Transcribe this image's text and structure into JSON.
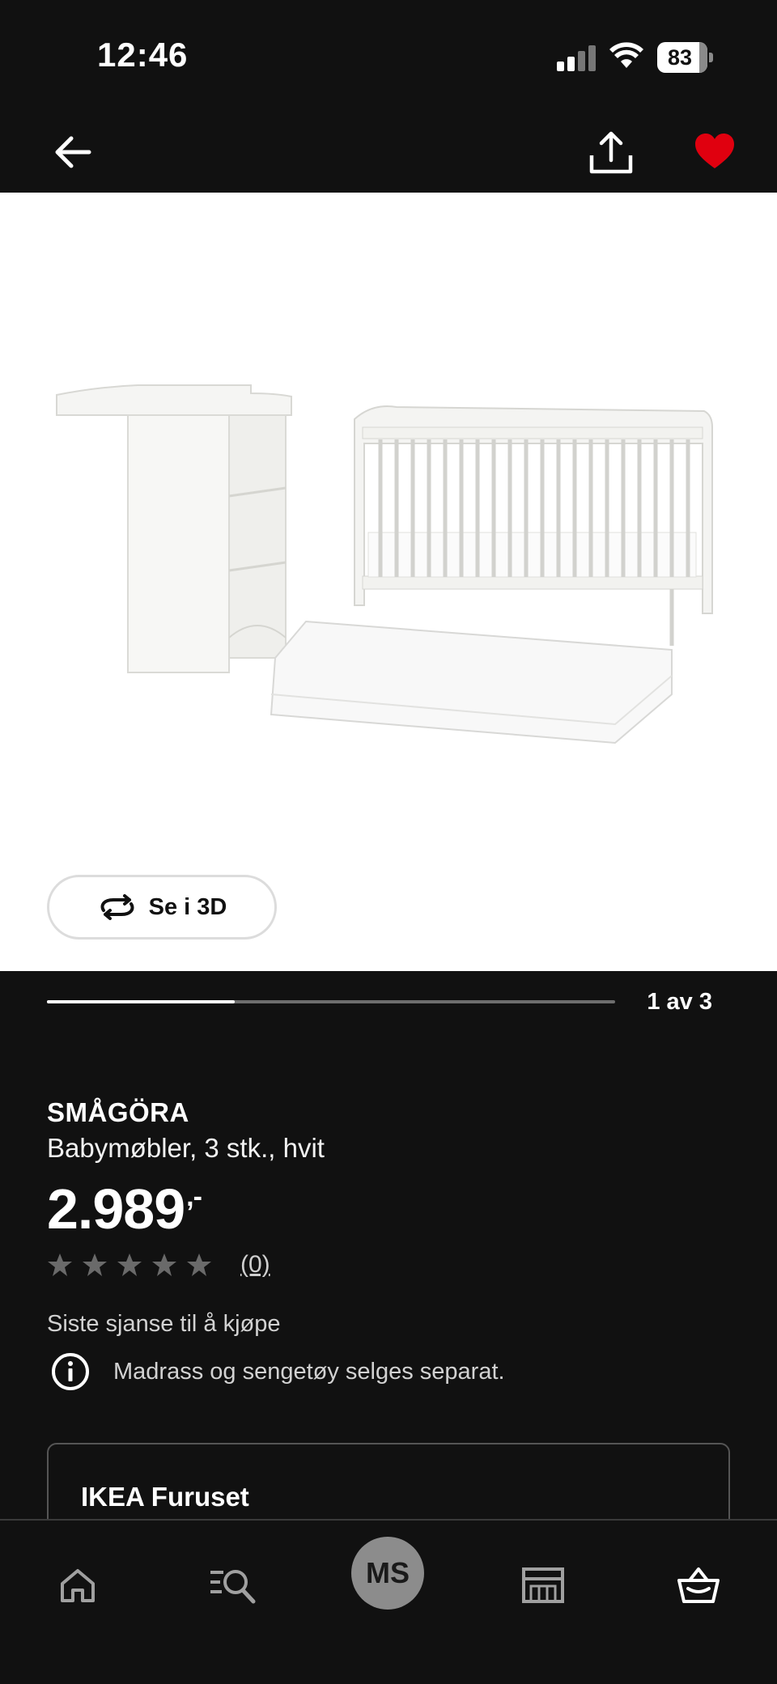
{
  "status_bar": {
    "time": "12:46",
    "battery": "83",
    "battery_level": 0.83
  },
  "header": {
    "back_icon": "arrow-left-icon",
    "share_icon": "share-icon",
    "favorite_icon": "heart-icon",
    "favorite_color": "#e0000f"
  },
  "gallery": {
    "view_3d_label": "Se i 3D",
    "position_label": "1 av 3",
    "position_fraction": 0.33
  },
  "product": {
    "brand": "SMÅGÖRA",
    "description": "Babymøbler, 3 stk., hvit",
    "price": "2.989",
    "price_suffix": ",-",
    "rating_stars": 0,
    "rating_count": "(0)",
    "availability": "Siste sjanse til å kjøpe",
    "notice": "Madrass og sengetøy selges separat."
  },
  "store": {
    "name": "IKEA Furuset"
  },
  "bottom_nav": {
    "items": [
      {
        "icon": "home-icon"
      },
      {
        "icon": "search-icon"
      },
      {
        "initials": "MS"
      },
      {
        "icon": "store-icon"
      },
      {
        "icon": "basket-icon"
      }
    ]
  },
  "colors": {
    "background": "#111111",
    "accent": "#e0000f"
  }
}
